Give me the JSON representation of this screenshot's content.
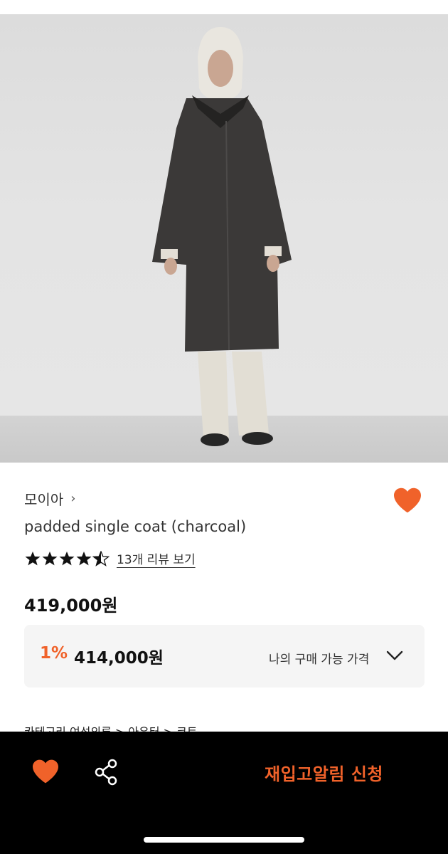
{
  "product": {
    "brand": "모이아",
    "brand_chevron": "›",
    "title": "padded single coat (charcoal)",
    "rating": 4.5,
    "review_link": "13개 리뷰 보기",
    "price": "419,000원",
    "discount": {
      "rate": "1%",
      "price": "414,000원",
      "label": "나의 구매 가능 가격"
    },
    "category_peek": "카테고리   여성의류 > 아우터 > 코트"
  },
  "icons": {
    "wishlist": "heart-icon",
    "share": "share-icon",
    "expand": "chevron-down-icon"
  },
  "bottom_bar": {
    "restock_label": "재입고알림 신청"
  },
  "colors": {
    "accent": "#f0622a",
    "bottom_bar_bg": "#000000"
  }
}
